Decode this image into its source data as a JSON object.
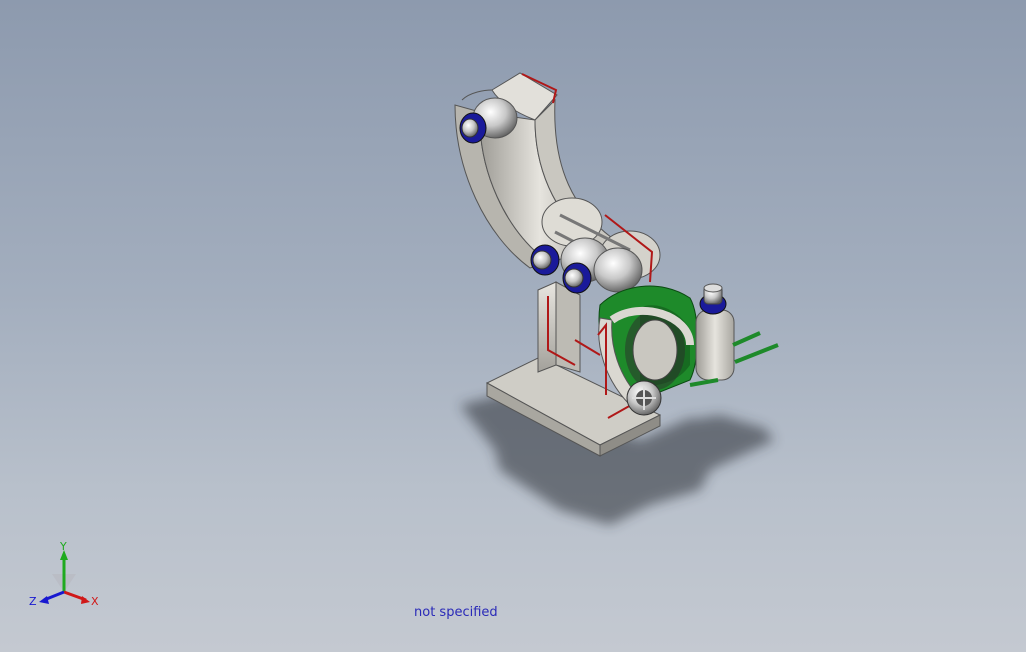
{
  "viewport": {
    "background_top": "#8d9aae",
    "background_bottom": "#c4c9d1",
    "model": {
      "body_color": "#d8d6d0",
      "accent_red": "#b01818",
      "accent_green": "#1e8a2a",
      "bearing_blue": "#1a1a9a"
    }
  },
  "triad": {
    "y_label": "Y",
    "x_label": "X",
    "z_label": "Z",
    "y_color": "#1faa1f",
    "x_color": "#d01818",
    "z_color": "#1818d0"
  },
  "status": {
    "material_text": "not specified"
  }
}
